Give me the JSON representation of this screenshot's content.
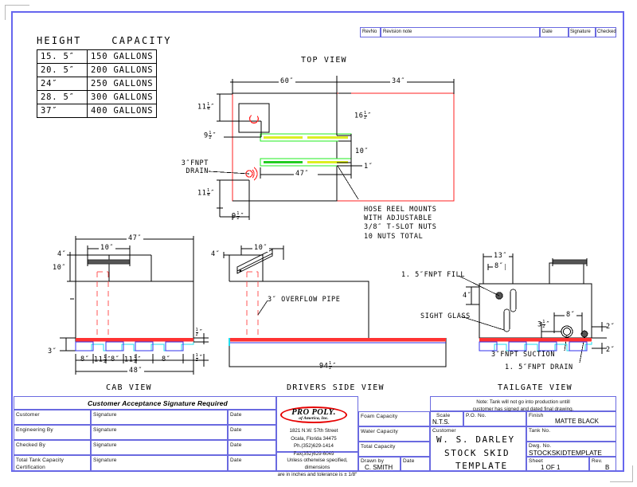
{
  "drawing": {
    "capacity_table": {
      "header_height": "HEIGHT",
      "header_capacity": "CAPACITY",
      "rows": [
        {
          "height": "15. 5″",
          "capacity": "150 GALLONS"
        },
        {
          "height": "20. 5″",
          "capacity": "200 GALLONS"
        },
        {
          "height": "24″",
          "capacity": "250 GALLONS"
        },
        {
          "height": "28. 5″",
          "capacity": "300 GALLONS"
        },
        {
          "height": "37″",
          "capacity": "400 GALLONS"
        }
      ]
    },
    "views": {
      "top": "TOP VIEW",
      "cab": "CAB VIEW",
      "drivers": "DRIVERS SIDE VIEW",
      "tailgate": "TAILGATE VIEW"
    },
    "top_view": {
      "dim_60": "60″",
      "dim_34": "34″",
      "dim_16_5": "16",
      "dim_16_5_num": "1",
      "dim_16_5_den": "2",
      "dim_10": "10″",
      "dim_1": "1″",
      "dim_47": "47″",
      "dim_11_25_a": "11",
      "dim_11_25_num": "1",
      "dim_11_25_den": "4",
      "dim_9_5_num": "1",
      "dim_9_5_den": "2",
      "dim_9": "9",
      "dim_11": "11",
      "callout_drain_l1": "3″FNPT",
      "callout_drain_l2": "DRAIN",
      "callout_reel_l1": "HOSE REEL MOUNTS",
      "callout_reel_l2": "WITH ADJUSTABLE",
      "callout_reel_l3": "3/8″ T-SLOT NUTS",
      "callout_reel_l4": "10 NUTS TOTAL"
    },
    "cab_view": {
      "dim_47": "47″",
      "dim_4": "4″",
      "dim_10_top": "10″",
      "dim_10_left": "10″",
      "dim_3": "3″",
      "dim_8a": "8″",
      "dim_8b": "8″",
      "dim_8c": "8″",
      "dim_11_5a": "11",
      "dim_11_5b": "11",
      "half_num": "1",
      "half_den": "2",
      "dim_48": "48″",
      "dim_half_r1": "2″",
      "dim_half_r2": "2″"
    },
    "drivers_view": {
      "dim_4": "4″",
      "dim_10": "10″",
      "callout_overflow": "3″ OVERFLOW PIPE",
      "dim_94_5": "94",
      "dim_94_5_num": "1",
      "dim_94_5_den": "2"
    },
    "tailgate_view": {
      "dim_13": "13″",
      "dim_8_top": "8″",
      "dim_4": "4″",
      "dim_8_right": "8″",
      "dim_3_5": "3",
      "dim_3_5_num": "1",
      "dim_3_5_den": "2",
      "dim_2a": "2″",
      "dim_2b": "2″",
      "callout_fill": "1. 5″FNPT FILL",
      "callout_sight": "SIGHT GLASS",
      "callout_suction": "3″FNPT SUCTION",
      "callout_drain": "1. 5″FNPT DRAIN"
    }
  },
  "revision_header": {
    "columns": [
      "RevNo",
      "Revision note",
      "Date",
      "Signature",
      "Checked"
    ]
  },
  "title_block": {
    "acceptance_banner": "Customer Acceptance Signature Required",
    "left_rows": [
      {
        "label": "Customer",
        "signature": "Signature",
        "date": "Date"
      },
      {
        "label": "Engineering  By",
        "signature": "Signature",
        "date": "Date"
      },
      {
        "label": "Checked  By",
        "signature": "Signature",
        "date": "Date"
      },
      {
        "label": "Total  Tank  Capacity\nCertification",
        "signature": "Signature",
        "date": "Date"
      }
    ],
    "left_row4_line1": "Total  Tank  Capacity",
    "left_row4_line2": "Certification",
    "logo": {
      "name": "PRO  POLY.",
      "sub": "of America, Inc.",
      "address_line1": "1821 N.W. 57th Street",
      "address_line2": "Ocala, Florida 34475",
      "address_line3": "Ph.(352)629-1414",
      "address_line4": "Fax(352)629-6049"
    },
    "tolerance_note_l1": "Unless  otherwise  specified,  dimensions",
    "tolerance_note_l2": "are  in  inches  and  tolerance  is  ± 1/8″",
    "capacity_fields": [
      {
        "label": "Foam  Capacity",
        "value": ""
      },
      {
        "label": "Water  Capacity",
        "value": ""
      },
      {
        "label": "Total  Capacity",
        "value": ""
      }
    ],
    "drawn_by_label": "Drawn  by",
    "drawn_by_value": "C.  SMITH",
    "date_label": "Date",
    "date_value": "",
    "production_note_l1": "Note: Tank  will  not  go  into  production  untill",
    "production_note_l2": "customer  has  signed  and  dated  final  drawing.",
    "scale_label": "Scale",
    "scale_value": "N.T.S.",
    "po_label": "P.O. No.",
    "po_value": "",
    "finish_label": "Finish",
    "finish_value": "MATTE  BLACK",
    "customer_label": "Customer",
    "customer_line1": "W. S.  DARLEY",
    "customer_line2": "STOCK  SKID",
    "customer_line3": "TEMPLATE",
    "tank_no_label": "Tank  No.",
    "tank_no_value": "",
    "dwg_no_label": "Dwg.  No.",
    "dwg_no_value": "STOCKSKIDTEMPLATE",
    "sheet_label": "Sheet",
    "sheet_value": "1  OF  1",
    "rev_label": "Rev.",
    "rev_value": "B"
  },
  "colors": {
    "frame_blue": "#6666ee",
    "tank_red": "#ff2020",
    "mount_green": "#22ee22",
    "mount_yellow": "#ddee22",
    "skid_blue": "#3333ee",
    "skid_cyan": "#22ddee",
    "logo_red": "#e60000"
  }
}
